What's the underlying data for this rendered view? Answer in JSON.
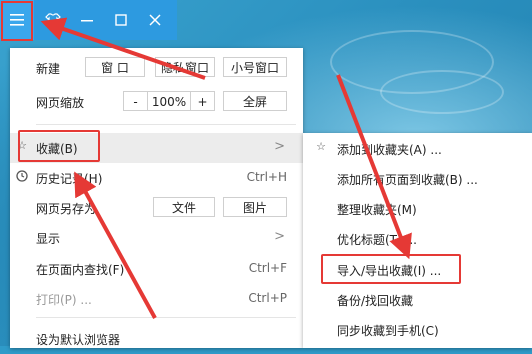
{
  "titlebar": {
    "icons": [
      "hamburger-menu-icon",
      "shirt-skin-icon",
      "minimize-icon",
      "maximize-icon",
      "close-icon"
    ]
  },
  "menu": {
    "new": {
      "label": "新建",
      "buttons": [
        "窗 口",
        "隐私窗口",
        "小号窗口"
      ]
    },
    "zoom": {
      "label": "网页缩放",
      "minus": "-",
      "value": "100%",
      "plus": "+",
      "fullscreen": "全屏"
    },
    "favorites": {
      "label": "收藏(B)",
      "arrow": ">"
    },
    "history": {
      "label": "历史记录(H)",
      "shortcut": "Ctrl+H"
    },
    "saveas": {
      "label": "网页另存为",
      "btn_file": "文件",
      "btn_image": "图片"
    },
    "display": {
      "label": "显示",
      "arrow": ">"
    },
    "find": {
      "label": "在页面内查找(F)",
      "shortcut": "Ctrl+F"
    },
    "print": {
      "label": "打印(P) ...",
      "shortcut": "Ctrl+P"
    },
    "default": {
      "label": "设为默认浏览器"
    }
  },
  "submenu": {
    "items": [
      {
        "label": "添加到收藏夹(A) ..."
      },
      {
        "label": "添加所有页面到收藏(B) ..."
      },
      {
        "label": "整理收藏夹(M)"
      },
      {
        "label": "优化标题(T) ..."
      },
      {
        "label": "导入/导出收藏(I) ..."
      },
      {
        "label": "备份/找回收藏"
      },
      {
        "label": "同步收藏到手机(C)"
      }
    ]
  },
  "colors": {
    "highlight": "#e53935",
    "titlebar": "#2d9ae0"
  }
}
